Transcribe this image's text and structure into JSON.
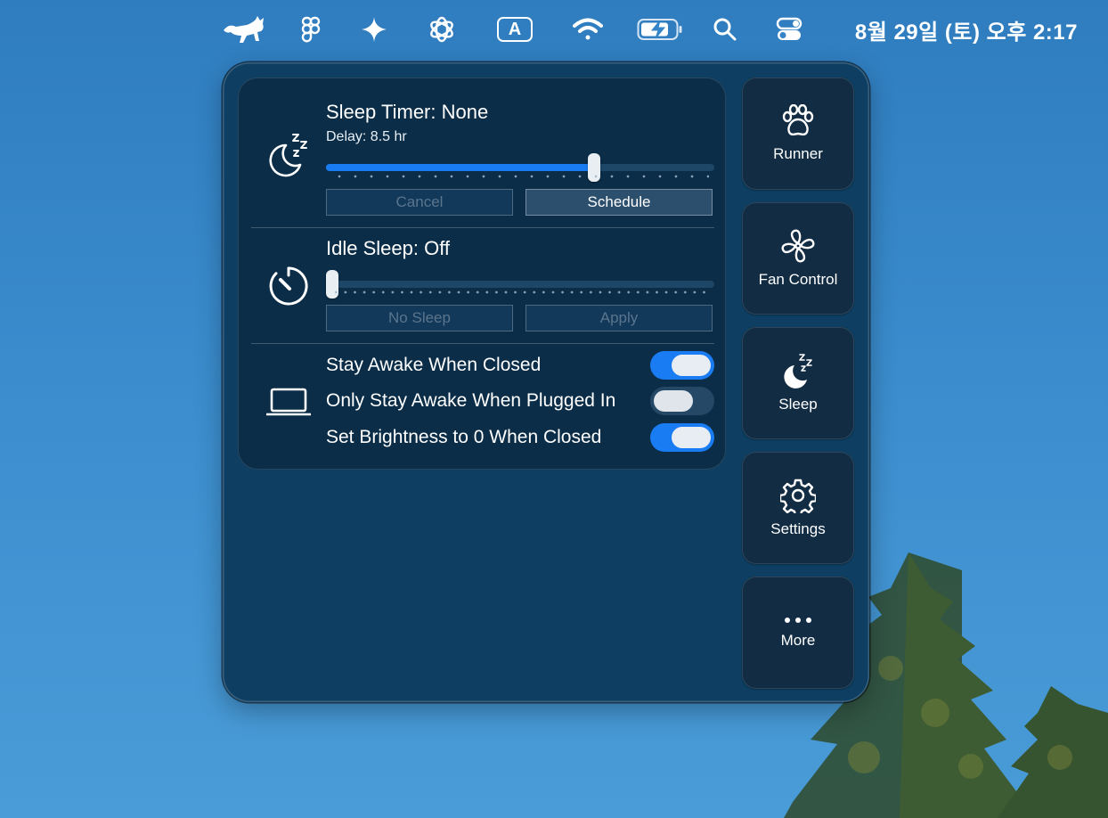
{
  "menubar": {
    "clock": "8월 29일 (토) 오후 2:17",
    "input_indicator": "A",
    "icons": [
      "runcat-icon",
      "figma-icon",
      "sparkle-icon",
      "chatgpt-icon",
      "input-source-icon",
      "wifi-icon",
      "battery-charging-icon",
      "spotlight-search-icon",
      "control-center-icon"
    ]
  },
  "sleep_timer": {
    "title": "Sleep Timer: None",
    "delay": "Delay: 8.5 hr",
    "value_fraction": 0.69,
    "cancel_label": "Cancel",
    "schedule_label": "Schedule"
  },
  "idle_sleep": {
    "title": "Idle Sleep: Off",
    "value_fraction": 0.0,
    "no_sleep_label": "No Sleep",
    "apply_label": "Apply"
  },
  "lid": {
    "toggles": [
      {
        "label": "Stay Awake When Closed",
        "on": true
      },
      {
        "label": "Only Stay Awake When Plugged In",
        "on": false
      },
      {
        "label": "Set Brightness to 0 When Closed",
        "on": true
      }
    ]
  },
  "sidebar": {
    "items": [
      {
        "label": "Runner",
        "icon": "paw-icon"
      },
      {
        "label": "Fan Control",
        "icon": "fan-icon"
      },
      {
        "label": "Sleep",
        "icon": "moon-zzz-icon"
      },
      {
        "label": "Settings",
        "icon": "gear-icon"
      },
      {
        "label": "More",
        "icon": "ellipsis-icon"
      }
    ]
  },
  "colors": {
    "accent": "#1a7cf2",
    "panel": "#0e3f63",
    "card": "#0b2d48"
  }
}
